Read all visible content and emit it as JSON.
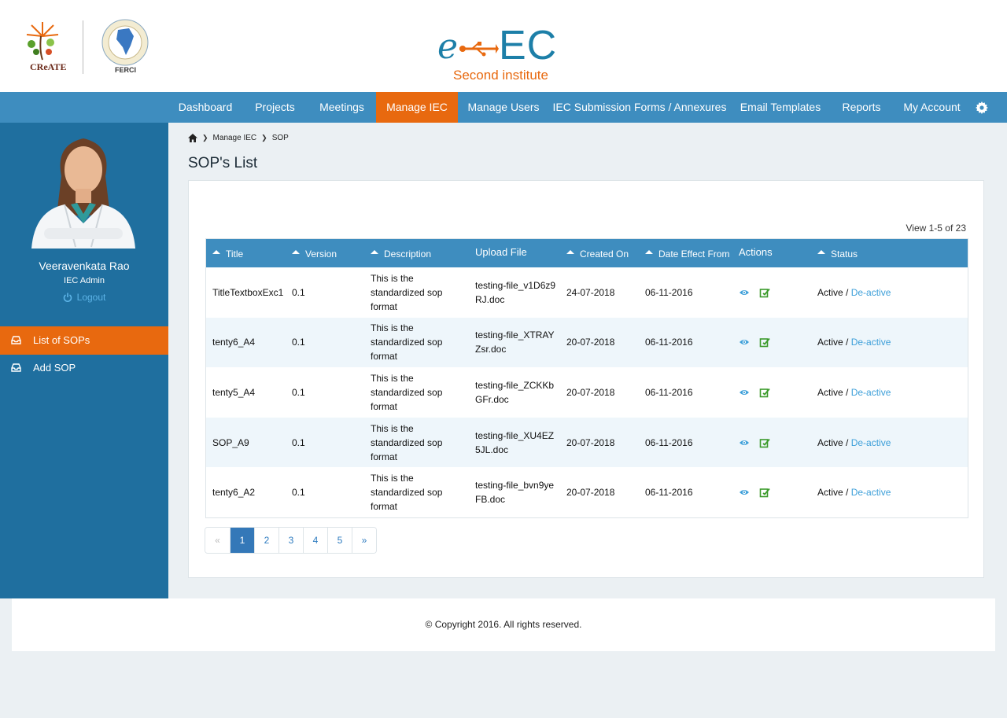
{
  "header": {
    "logo_create_text": "CReATE",
    "logo_ferci_text": "FERCI",
    "brand_e": "e",
    "brand_ec": "EC",
    "brand_subtitle": "Second institute"
  },
  "nav": {
    "items": [
      "Dashboard",
      "Projects",
      "Meetings",
      "Manage IEC",
      "Manage Users",
      "IEC Submission Forms / Annexures",
      "Email Templates",
      "Reports",
      "My Account"
    ],
    "active": "Manage IEC"
  },
  "sidebar": {
    "user_name": "Veeravenkata Rao",
    "user_role": "IEC Admin",
    "logout_label": "Logout",
    "items": [
      {
        "label": "List of SOPs",
        "active": true
      },
      {
        "label": "Add SOP",
        "active": false
      }
    ]
  },
  "breadcrumb": [
    "Manage IEC",
    "SOP"
  ],
  "page_title": "SOP's List",
  "view_count": "View 1-5 of 23",
  "table": {
    "headers": {
      "title": "Title",
      "version": "Version",
      "description": "Description",
      "upload_file": "Upload File",
      "created_on": "Created On",
      "date_effect_from": "Date Effect From",
      "actions": "Actions",
      "status": "Status"
    },
    "rows": [
      {
        "title": "TitleTextboxExc1",
        "version": "0.1",
        "description": "This is the standardized sop format",
        "file": "testing-file_v1D6z9RJ.doc",
        "created": "24-07-2018",
        "effect": "06-11-2016",
        "status_active": "Active",
        "status_sep": " / ",
        "status_deactive": "De-active"
      },
      {
        "title": "tenty6_A4",
        "version": "0.1",
        "description": "This is the standardized sop format",
        "file": "testing-file_XTRAYZsr.doc",
        "created": "20-07-2018",
        "effect": "06-11-2016",
        "status_active": "Active",
        "status_sep": " / ",
        "status_deactive": "De-active"
      },
      {
        "title": "tenty5_A4",
        "version": "0.1",
        "description": "This is the standardized sop format",
        "file": "testing-file_ZCKKbGFr.doc",
        "created": "20-07-2018",
        "effect": "06-11-2016",
        "status_active": "Active",
        "status_sep": " / ",
        "status_deactive": "De-active"
      },
      {
        "title": "SOP_A9",
        "version": "0.1",
        "description": "This is the standardized sop format",
        "file": "testing-file_XU4EZ5JL.doc",
        "created": "20-07-2018",
        "effect": "06-11-2016",
        "status_active": "Active",
        "status_sep": " / ",
        "status_deactive": "De-active"
      },
      {
        "title": "tenty6_A2",
        "version": "0.1",
        "description": "This is the standardized sop format",
        "file": "testing-file_bvn9yeFB.doc",
        "created": "20-07-2018",
        "effect": "06-11-2016",
        "status_active": "Active",
        "status_sep": " / ",
        "status_deactive": "De-active"
      }
    ]
  },
  "pagination": {
    "prev": "«",
    "pages": [
      "1",
      "2",
      "3",
      "4",
      "5"
    ],
    "next": "»",
    "current": "1"
  },
  "footer": "© Copyright 2016. All rights reserved.",
  "colors": {
    "nav_bg": "#3e8dbf",
    "accent": "#e8690f",
    "sidebar_bg": "#1f6f9f",
    "link": "#3d9fd9"
  },
  "icons": [
    "home-icon",
    "chevron-right-icon",
    "caret-up-icon",
    "eye-icon",
    "edit-icon",
    "gear-icon",
    "power-icon",
    "inbox-icon"
  ]
}
